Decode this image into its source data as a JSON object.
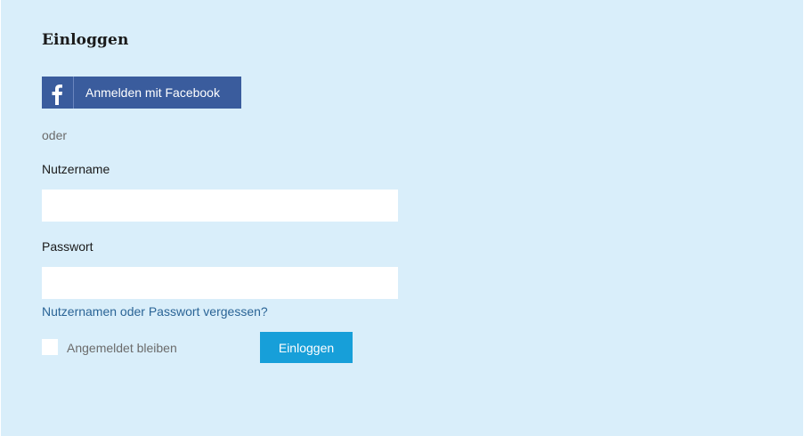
{
  "login": {
    "title": "Einloggen",
    "facebook_button": {
      "label": "Anmelden mit Facebook",
      "icon": "facebook-f-icon",
      "color": "#3a5c9d"
    },
    "separator_text": "oder",
    "username": {
      "label": "Nutzername",
      "value": "",
      "placeholder": ""
    },
    "password": {
      "label": "Passwort",
      "value": "",
      "placeholder": ""
    },
    "forgot_link": "Nutzernamen oder Passwort vergessen?",
    "remember_me": {
      "label": "Angemeldet bleiben",
      "checked": false
    },
    "submit_button": {
      "label": "Einloggen",
      "color": "#179fd9"
    },
    "background_color": "#d9eefa"
  }
}
